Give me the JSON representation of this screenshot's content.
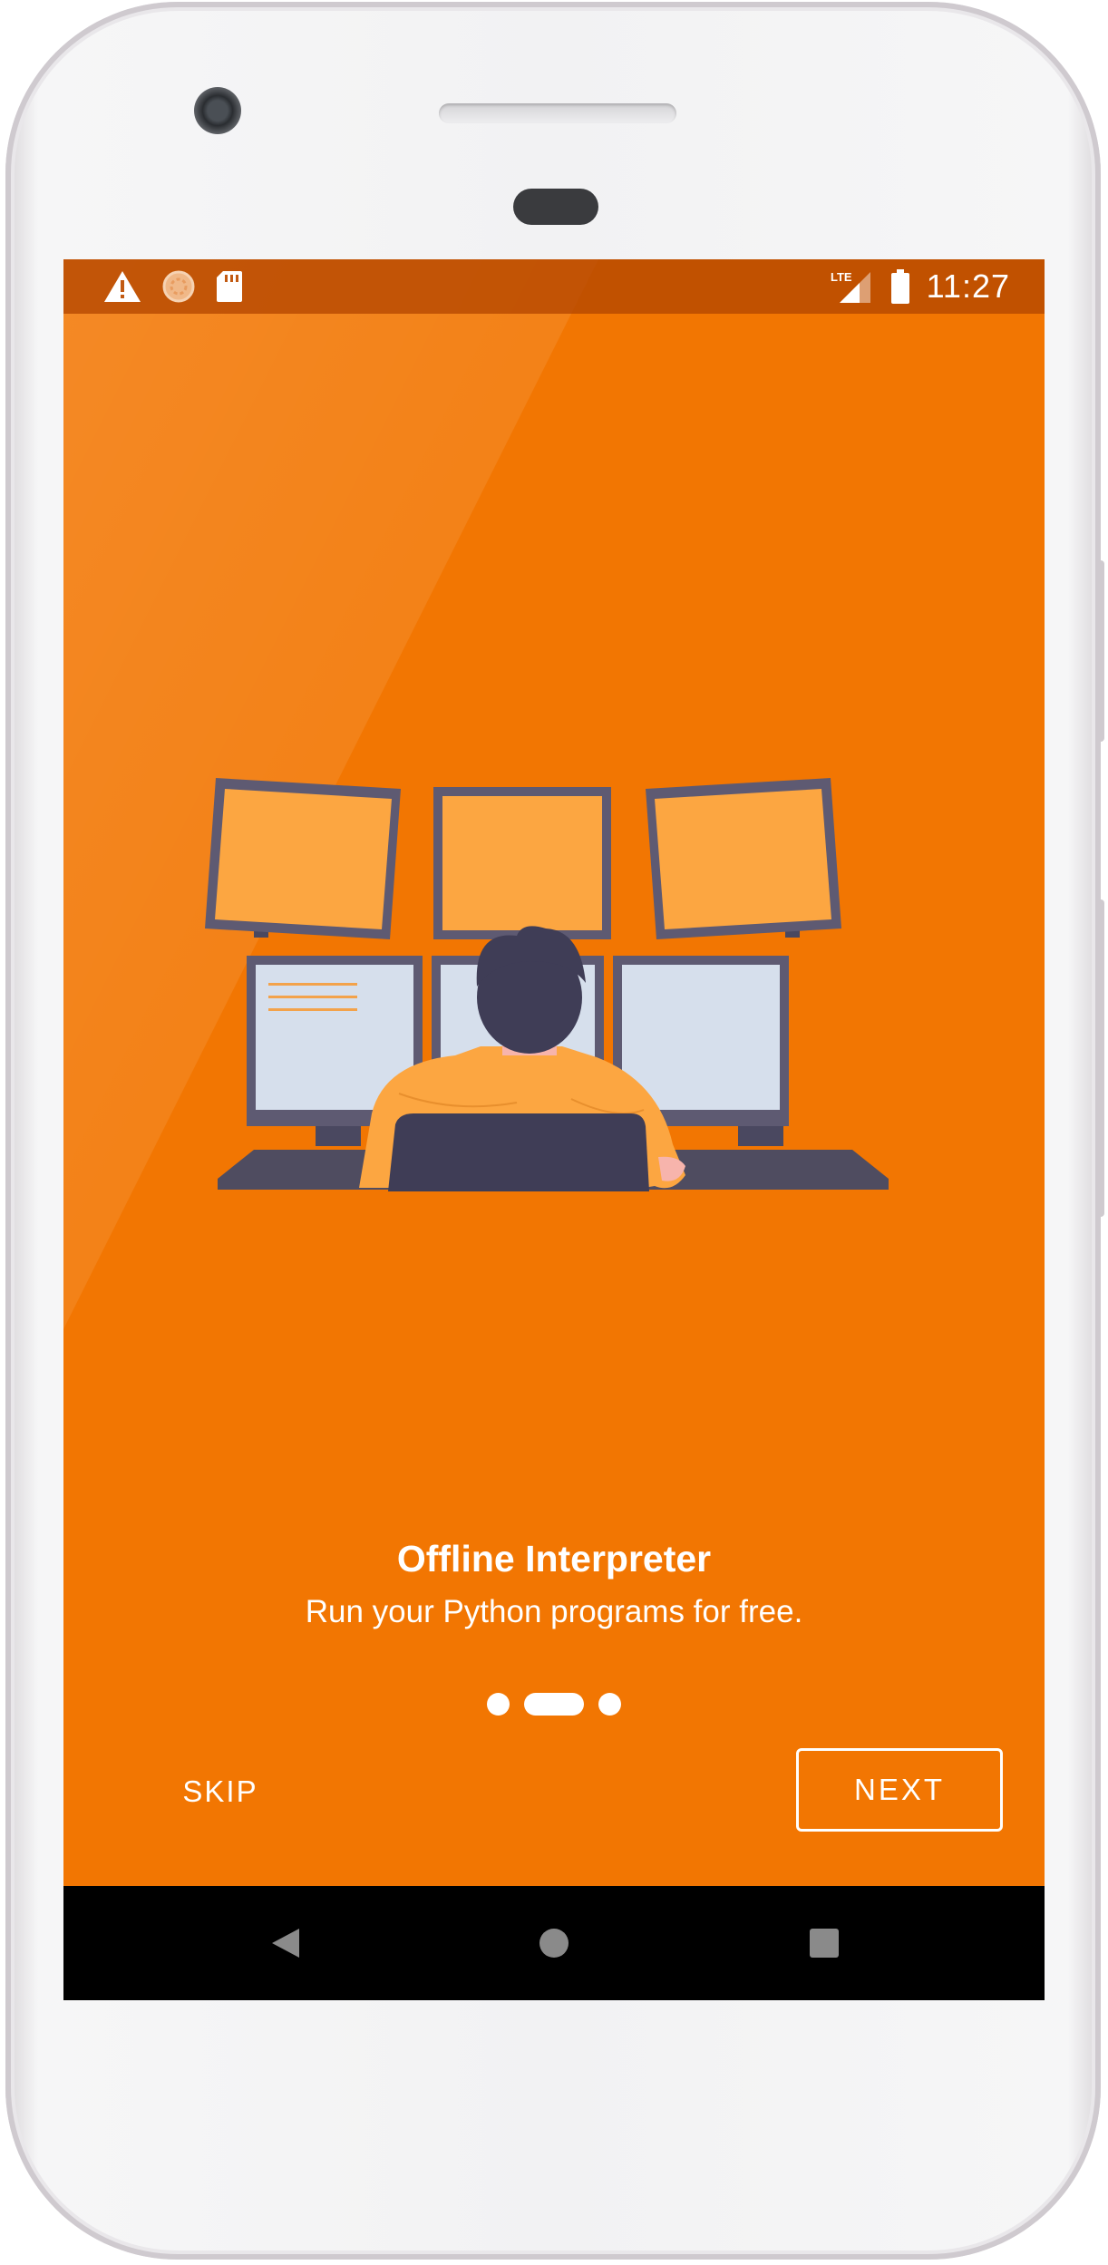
{
  "status_bar": {
    "left_icons": [
      "warning-icon",
      "sync-icon",
      "sd-card-icon"
    ],
    "right_icons": [
      "lte-signal-icon",
      "battery-icon"
    ],
    "network_label": "LTE",
    "time": "11:27"
  },
  "onboarding": {
    "illustration": "developer-at-multi-monitor-desk",
    "title": "Offline Interpreter",
    "subtitle": "Run your Python programs for free.",
    "page_indicator": {
      "total": 3,
      "current": 2
    },
    "skip_label": "SKIP",
    "next_label": "NEXT"
  },
  "nav_bar": {
    "items": [
      "back-icon",
      "home-icon",
      "recents-icon"
    ]
  },
  "colors": {
    "accent": "#f27602",
    "status_bar": "#b34600",
    "nav_bar": "#000000",
    "illustration_panel": "#fca641",
    "monitor_frame": "#5e5a72",
    "screen_light": "#d6dfec",
    "hair": "#3f3d56"
  }
}
